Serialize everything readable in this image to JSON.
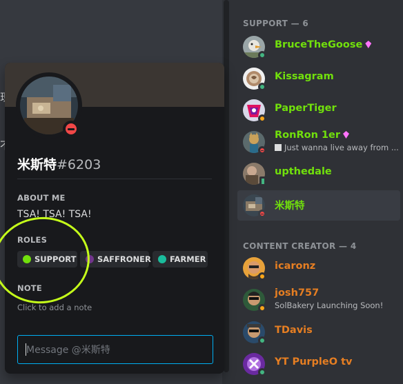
{
  "chat": {
    "text_fragment_1": "现",
    "text_fragment_2": "不"
  },
  "profile": {
    "username": "米斯特",
    "discriminator": "#6203",
    "status": "dnd",
    "about_me_label": "ABOUT ME",
    "about_me_text": "TSA! TSA! TSA!",
    "roles_label": "ROLES",
    "roles": [
      {
        "name": "SUPPORT",
        "color": "#71e00c"
      },
      {
        "name": "SAFFRONER",
        "color": "#71368a"
      },
      {
        "name": "FARMER",
        "color": "#1abc9c"
      }
    ],
    "note_label": "NOTE",
    "note_placeholder": "Click to add a note",
    "message_placeholder": "Message @米斯特"
  },
  "member_list": {
    "sections": [
      {
        "header": "SUPPORT — 6",
        "members": [
          {
            "name": "BruceTheGoose",
            "status": "online",
            "booster": true,
            "color": "#71e00c"
          },
          {
            "name": "Kissagram",
            "status": "online",
            "booster": false,
            "color": "#71e00c"
          },
          {
            "name": "PaperTiger",
            "status": "idle",
            "booster": false,
            "color": "#71e00c"
          },
          {
            "name": "RonRon 1er",
            "status": "dnd",
            "booster": true,
            "color": "#71e00c",
            "activity": "Just wanna live away from ..."
          },
          {
            "name": "upthedale",
            "status": "online",
            "booster": false,
            "color": "#71e00c"
          },
          {
            "name": "米斯特",
            "status": "dnd",
            "booster": false,
            "color": "#71e00c",
            "selected": true
          }
        ]
      },
      {
        "header": "CONTENT CREATOR — 4",
        "members": [
          {
            "name": "icaronz",
            "status": "idle",
            "booster": false,
            "color": "#e67e22"
          },
          {
            "name": "josh757",
            "status": "idle",
            "booster": false,
            "color": "#e67e22",
            "activity": "SolBakery Launching Soon!"
          },
          {
            "name": "TDavis",
            "status": "online",
            "booster": false,
            "color": "#e67e22"
          },
          {
            "name": "YT PurpleO tv",
            "status": "online",
            "booster": false,
            "color": "#e67e22"
          }
        ]
      }
    ]
  }
}
